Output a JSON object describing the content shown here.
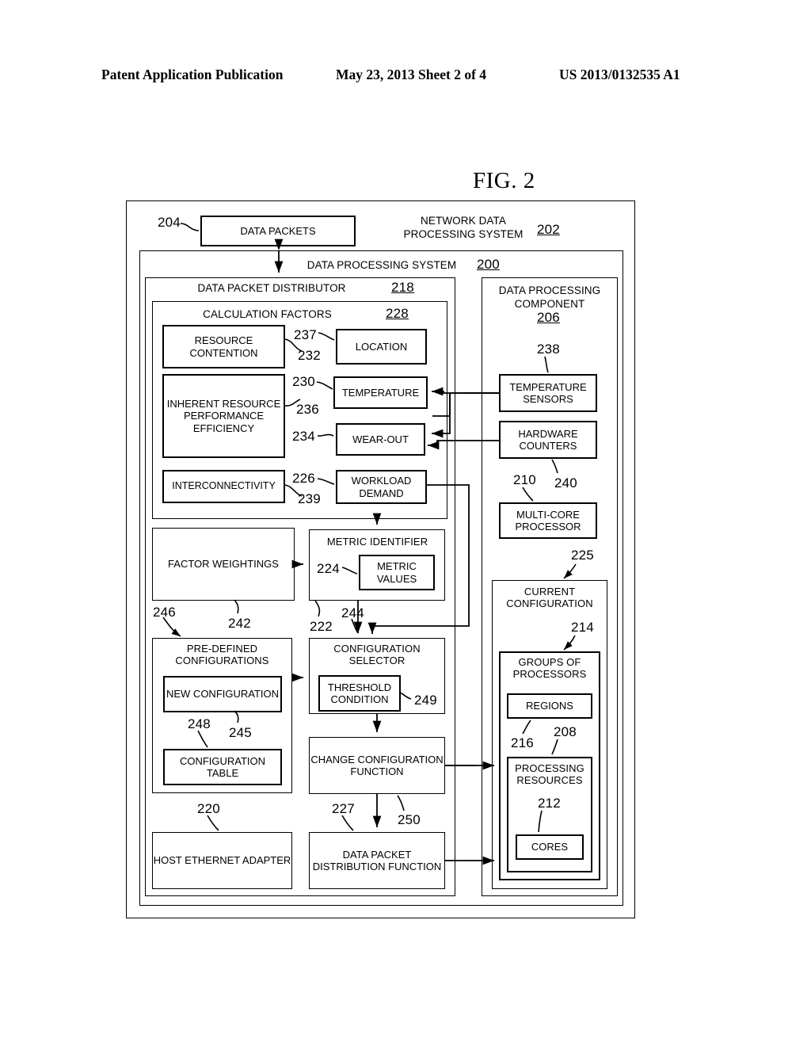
{
  "header": {
    "publication": "Patent Application Publication",
    "date_sheet": "May 23, 2013  Sheet 2 of 4",
    "patent_number": "US 2013/0132535 A1"
  },
  "figure": {
    "label": "FIG. 2"
  },
  "diagram": {
    "outer": {
      "title": "NETWORK DATA\nPROCESSING SYSTEM",
      "ref": "202"
    },
    "data_packets": {
      "label": "DATA PACKETS",
      "ref": "204"
    },
    "dps": {
      "title": "DATA PROCESSING SYSTEM",
      "ref": "200"
    },
    "distributor": {
      "title": "DATA PACKET DISTRIBUTOR",
      "ref": "218"
    },
    "calc_factors": {
      "title": "CALCULATION FACTORS",
      "ref": "228"
    },
    "factors_left": [
      {
        "label": "RESOURCE\nCONTENTION"
      },
      {
        "label": "INHERENT\nRESOURCE\nPERFORMANCE\nEFFICIENCY"
      },
      {
        "label": "INTERCONNECTIVITY"
      }
    ],
    "factors_right": [
      {
        "label": "LOCATION"
      },
      {
        "label": "TEMPERATURE"
      },
      {
        "label": "WEAR-OUT"
      },
      {
        "label": "WORKLOAD\nDEMAND"
      }
    ],
    "factor_refs": {
      "r237": "237",
      "r232": "232",
      "r230": "230",
      "r236": "236",
      "r234": "234",
      "r226": "226",
      "r239": "239"
    },
    "factor_weightings": {
      "label": "FACTOR\nWEIGHTINGS",
      "ref": "242"
    },
    "metric_identifier": {
      "label": "METRIC IDENTIFIER",
      "ref": "222"
    },
    "metric_values": {
      "label": "METRIC\nVALUES",
      "ref": "224"
    },
    "predefined_configs": {
      "label": "PRE-DEFINED\nCONFIGURATIONS",
      "ref": "246"
    },
    "new_configuration": {
      "label": "NEW\nCONFIGURATION",
      "ref": "245"
    },
    "configuration_table": {
      "label": "CONFIGURATION\nTABLE",
      "ref": "248"
    },
    "config_selector": {
      "label": "CONFIGURATION\nSELECTOR",
      "ref": "244"
    },
    "threshold_condition": {
      "label": "THRESHOLD\nCONDITION",
      "ref": "249"
    },
    "change_config_fn": {
      "label": "CHANGE\nCONFIGURATION\nFUNCTION",
      "ref": "227"
    },
    "host_ethernet_adapter": {
      "label": "HOST ETHERNET\nADAPTER",
      "ref": "220"
    },
    "data_packet_dist_fn": {
      "label": "DATA PACKET\nDISTRIBUTION\nFUNCTION",
      "ref": "250"
    },
    "dp_component": {
      "title": "DATA PROCESSING\nCOMPONENT",
      "ref": "206"
    },
    "temperature_sensors": {
      "label": "TEMPERATURE\nSENSORS",
      "ref": "238"
    },
    "hardware_counters": {
      "label": "HARDWARE\nCOUNTERS",
      "ref": "240"
    },
    "multicore_processor": {
      "label": "MULTI-CORE\nPROCESSOR",
      "ref": "210"
    },
    "current_configuration": {
      "label": "CURRENT\nCONFIGURATION",
      "ref": "225"
    },
    "groups_of_processors": {
      "label": "GROUPS OF\nPROCESSORS",
      "ref": "214"
    },
    "regions": {
      "label": "REGIONS",
      "ref": "216"
    },
    "processing_resources": {
      "label": "PROCESSING\nRESOURCES",
      "ref": "208"
    },
    "cores": {
      "label": "CORES",
      "ref": "212"
    }
  }
}
